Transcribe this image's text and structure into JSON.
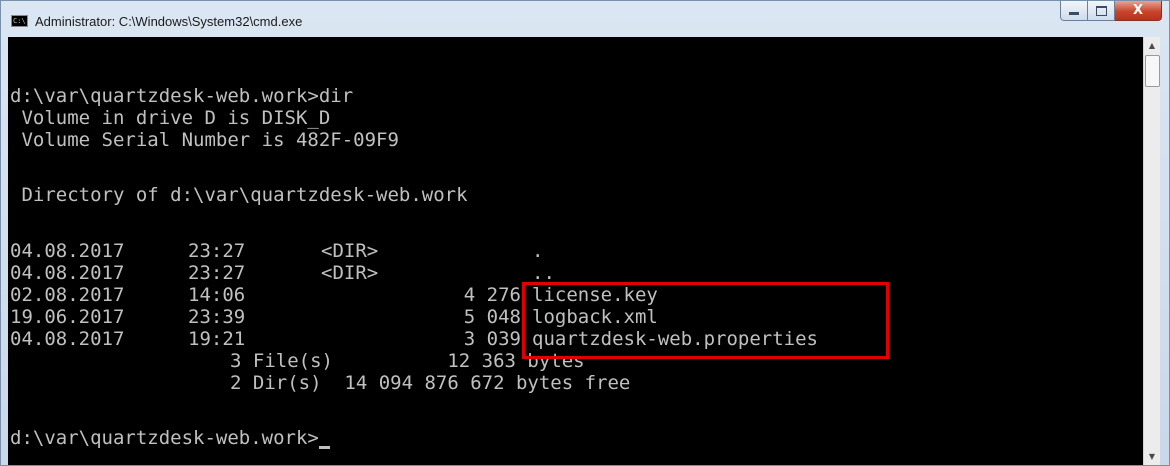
{
  "window": {
    "title": "Administrator: C:\\Windows\\System32\\cmd.exe",
    "app_icon_text": "C:\\",
    "close_glyph": "X"
  },
  "console": {
    "command_line": "d:\\var\\quartzdesk-web.work>dir",
    "volume_line": " Volume in drive D is DISK_D",
    "serial_line": " Volume Serial Number is 482F-09F9",
    "directory_line": " Directory of d:\\var\\quartzdesk-web.work",
    "entries": [
      {
        "date": "04.08.2017",
        "time": "23:27",
        "dir": "<DIR>",
        "size": "",
        "name": "."
      },
      {
        "date": "04.08.2017",
        "time": "23:27",
        "dir": "<DIR>",
        "size": "",
        "name": ".."
      },
      {
        "date": "02.08.2017",
        "time": "14:06",
        "dir": "",
        "size": "4 276",
        "name": "license.key"
      },
      {
        "date": "19.06.2017",
        "time": "23:39",
        "dir": "",
        "size": "5 048",
        "name": "logback.xml"
      },
      {
        "date": "04.08.2017",
        "time": "19:21",
        "dir": "",
        "size": "3 039",
        "name": "quartzdesk-web.properties"
      }
    ],
    "files_summary": "3 File(s)          12 363 bytes",
    "dirs_summary": "2 Dir(s)  14 094 876 672 bytes free",
    "prompt": "d:\\var\\quartzdesk-web.work>"
  },
  "colors": {
    "console_bg": "#000000",
    "console_fg": "#c0c0c0",
    "highlight": "#e00000"
  }
}
